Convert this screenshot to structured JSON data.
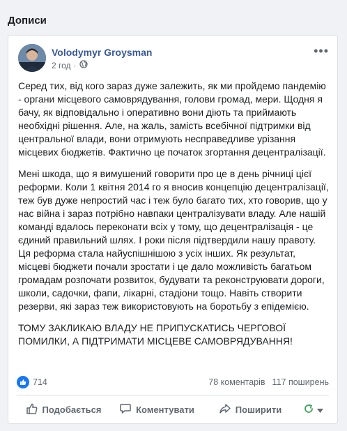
{
  "section": {
    "title": "Дописи"
  },
  "post": {
    "author": "Volodymyr Groysman",
    "time": "2 год",
    "paragraphs": [
      "Серед тих, від кого зараз дуже залежить, як ми пройдемо пандемію - органи місцевого самоврядування, голови громад, мери. Щодня я бачу, як відповідально і оперативно вони діють та приймають необхідні рішення. Але, на жаль, замість всебічної підтримки від центральної влади, вони отримують несправедливе урізання місцевих бюджетів. Фактично це початок згортання децентралізації.",
      "Мені шкода, що я вимушений говорити про це в день річниці цієї реформи. Коли 1 квітня 2014 го я вносив концепцію децентралізації, теж був дуже непростий час і теж було багато тих, хто говорив, що у нас війна і зараз потрібно навпаки централізувати владу. Але нашій команді вдалось переконати всіх у тому, що децентралізація - це єдиний правильний шлях. І роки після підтвердили нашу правоту. Ця реформа стала найуспішнішою з усіх інших. Як результат, місцеві бюджети почали зростати і це дало можливість багатьом громадам розпочати розвиток, будувати та реконструювати дороги, школи, садочки, фапи, лікарні, стадіони тощо. Навіть створити резерви, які зараз теж використовують на боротьбу з епідемією.",
      "ТОМУ ЗАКЛИКАЮ ВЛАДУ НЕ ПРИПУСКАТИСЬ ЧЕРГОВОЇ ПОМИЛКИ, А ПІДТРИМАТИ МІСЦЕВЕ САМОВРЯДУВАННЯ!"
    ],
    "likes": "714",
    "comments": "78 коментарів",
    "shares": "117 поширень"
  },
  "actions": {
    "like": "Подобається",
    "comment": "Коментувати",
    "share": "Поширити"
  },
  "icons": {
    "privacy": "globe-icon",
    "more": "more-icon",
    "like_badge": "thumbs-up-icon"
  },
  "colors": {
    "author": "#385898",
    "accent": "#1877f2"
  }
}
